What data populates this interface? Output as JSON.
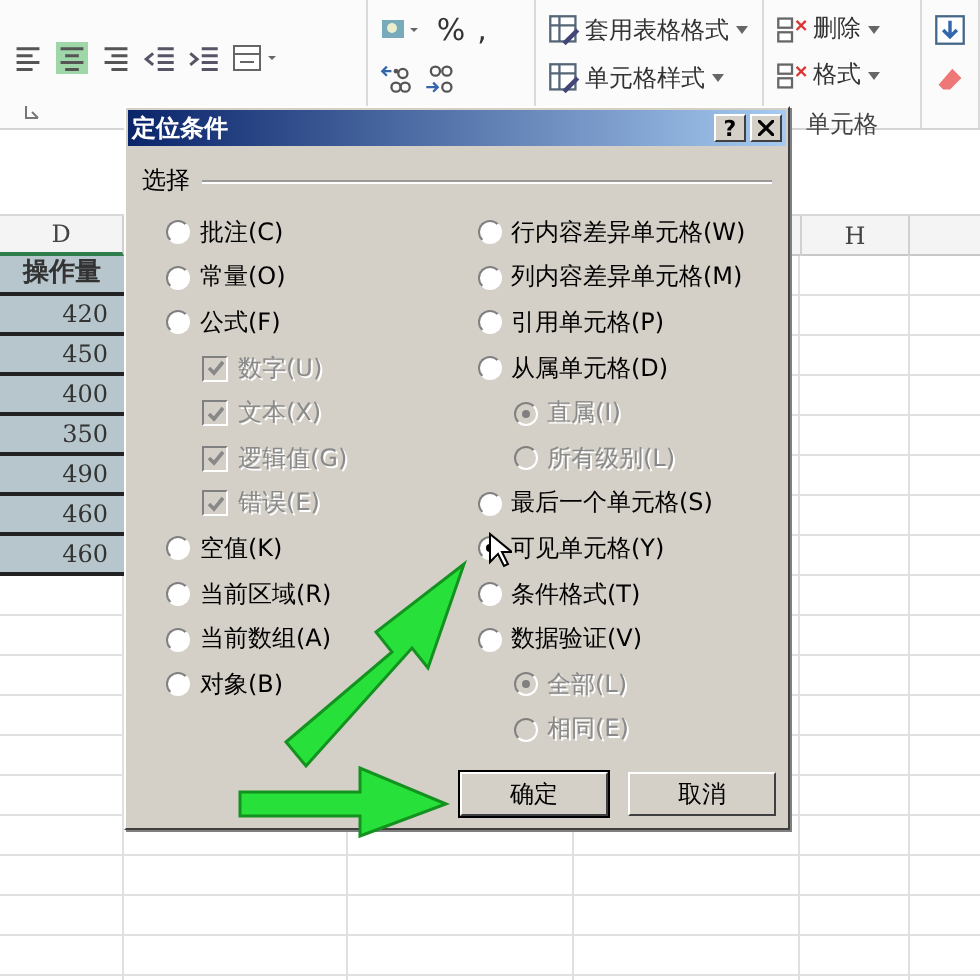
{
  "ribbon": {
    "number": {
      "symbols": [
        "%",
        ","
      ]
    },
    "styles": [
      {
        "label": "套用表格格式",
        "dropdown": true
      },
      {
        "label": "单元格样式",
        "dropdown": true
      }
    ],
    "cells": {
      "items": [
        {
          "label": "删除",
          "dropdown": true
        },
        {
          "label": "格式",
          "dropdown": true
        }
      ],
      "group_label": "单元格"
    }
  },
  "sheet": {
    "columns": [
      "D",
      "H"
    ],
    "header": "操作量",
    "values": [
      "420",
      "450",
      "400",
      "350",
      "490",
      "460",
      "460"
    ]
  },
  "dialog": {
    "title": "定位条件",
    "help": "?",
    "group_label": "选择",
    "left": [
      {
        "kind": "radio",
        "label": "批注(C)",
        "selected": false,
        "disabled": false
      },
      {
        "kind": "radio",
        "label": "常量(O)",
        "selected": false,
        "disabled": false
      },
      {
        "kind": "radio",
        "label": "公式(F)",
        "selected": false,
        "disabled": false,
        "children": [
          {
            "kind": "checkbox",
            "label": "数字(U)",
            "checked": true,
            "disabled": true
          },
          {
            "kind": "checkbox",
            "label": "文本(X)",
            "checked": true,
            "disabled": true
          },
          {
            "kind": "checkbox",
            "label": "逻辑值(G)",
            "checked": true,
            "disabled": true
          },
          {
            "kind": "checkbox",
            "label": "错误(E)",
            "checked": true,
            "disabled": true
          }
        ]
      },
      {
        "kind": "radio",
        "label": "空值(K)",
        "selected": false,
        "disabled": false
      },
      {
        "kind": "radio",
        "label": "当前区域(R)",
        "selected": false,
        "disabled": false
      },
      {
        "kind": "radio",
        "label": "当前数组(A)",
        "selected": false,
        "disabled": false
      },
      {
        "kind": "radio",
        "label": "对象(B)",
        "selected": false,
        "disabled": false
      }
    ],
    "right": [
      {
        "kind": "radio",
        "label": "行内容差异单元格(W)",
        "selected": false,
        "disabled": false
      },
      {
        "kind": "radio",
        "label": "列内容差异单元格(M)",
        "selected": false,
        "disabled": false
      },
      {
        "kind": "radio",
        "label": "引用单元格(P)",
        "selected": false,
        "disabled": false
      },
      {
        "kind": "radio",
        "label": "从属单元格(D)",
        "selected": false,
        "disabled": false,
        "children": [
          {
            "kind": "radio",
            "label": "直属(I)",
            "selected": true,
            "disabled": true
          },
          {
            "kind": "radio",
            "label": "所有级别(L)",
            "selected": false,
            "disabled": true
          }
        ]
      },
      {
        "kind": "radio",
        "label": "最后一个单元格(S)",
        "selected": false,
        "disabled": false
      },
      {
        "kind": "radio",
        "label": "可见单元格(Y)",
        "selected": true,
        "disabled": false
      },
      {
        "kind": "radio",
        "label": "条件格式(T)",
        "selected": false,
        "disabled": false
      },
      {
        "kind": "radio",
        "label": "数据验证(V)",
        "selected": false,
        "disabled": false,
        "children": [
          {
            "kind": "radio",
            "label": "全部(L)",
            "selected": true,
            "disabled": true
          },
          {
            "kind": "radio",
            "label": "相同(E)",
            "selected": false,
            "disabled": true
          }
        ]
      }
    ],
    "buttons": [
      {
        "label": "确定",
        "default": true
      },
      {
        "label": "取消",
        "default": false
      }
    ]
  }
}
